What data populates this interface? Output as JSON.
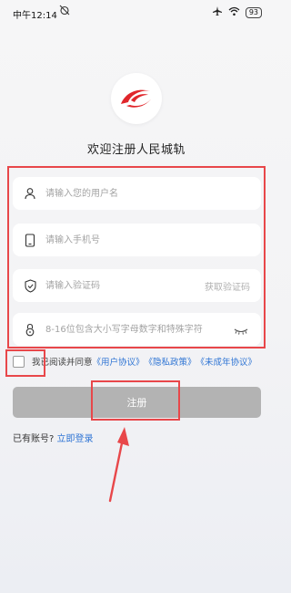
{
  "status_bar": {
    "time": "中午12:14",
    "battery": "93"
  },
  "welcome_title": "欢迎注册人民城轨",
  "form": {
    "username_placeholder": "请输入您的用户名",
    "phone_placeholder": "请输入手机号",
    "code_placeholder": "请输入验证码",
    "get_code_label": "获取验证码",
    "password_placeholder": "8-16位包含大小写字母数字和特殊字符"
  },
  "agreement": {
    "prefix": "我已阅读并同意",
    "user_agreement": "《用户协议》",
    "privacy_policy": "《隐私政策》",
    "minor_agreement": "《未成年协议》"
  },
  "register_label": "注册",
  "login_prompt": "已有账号?",
  "login_link": "立即登录",
  "colors": {
    "accent": "#2e74d4",
    "highlight": "#e8474a",
    "logo_red": "#e0262b",
    "button_disabled": "#b3b3b3"
  }
}
